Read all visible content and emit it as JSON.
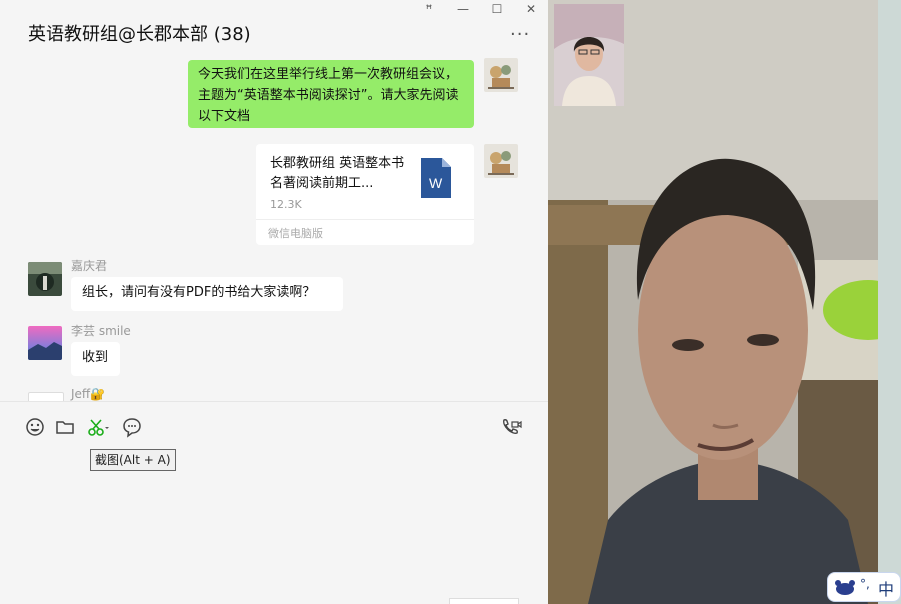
{
  "window": {
    "title": "英语教研组@长郡本部 (38)",
    "controls": {
      "pin": "ꟸ",
      "minimize": "—",
      "maximize": "☐",
      "close": "✕"
    },
    "more": "···"
  },
  "messages": [
    {
      "type": "text",
      "side": "right",
      "text": "今天我们在这里举行线上第一次教研组会议，主题为“英语整本书阅读探讨”。请大家先阅读以下文档"
    },
    {
      "type": "file",
      "side": "right",
      "file_name": "长郡教研组 英语整本书名著阅读前期工...",
      "file_size": "12.3K",
      "source": "微信电脑版",
      "file_icon_letter": "W"
    },
    {
      "type": "text",
      "side": "left",
      "sender": "嘉庆君",
      "text": "组长，请问有没有PDF的书给大家读啊？"
    },
    {
      "type": "text",
      "side": "left",
      "sender": "李芸 smile",
      "text": "收到"
    },
    {
      "type": "partial",
      "side": "left",
      "sender": "Jeff🔐"
    }
  ],
  "toolbar": {
    "tools": [
      "emoji-icon",
      "folder-icon",
      "scissors-icon",
      "chat-bubble-icon",
      "video-call-icon"
    ],
    "tooltip": "截图(Alt + A)"
  },
  "ime": {
    "label": "中",
    "mode_mark": "°,"
  },
  "colors": {
    "bubble_self": "#95ec69",
    "bubble_other": "#ffffff",
    "panel_bg": "#f5f5f5",
    "word_blue": "#2b579a",
    "scissors_green": "#1aad19"
  }
}
